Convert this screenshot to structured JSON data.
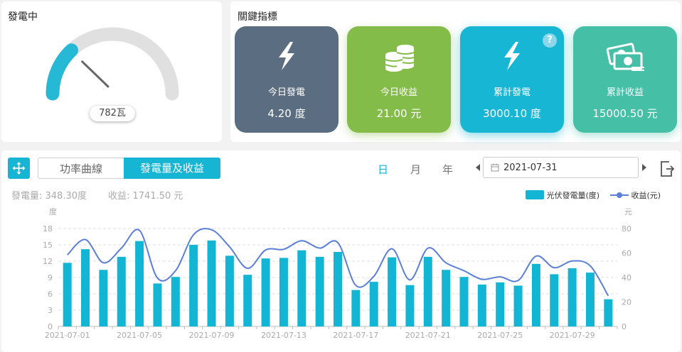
{
  "generating": {
    "title": "發電中",
    "value_text": "782瓦",
    "level": 0.26
  },
  "kpi": {
    "title": "關鍵指標",
    "cards": [
      {
        "label": "今日發電",
        "value": "4.20 度",
        "icon": "lightning-icon",
        "color": "#5b6d80"
      },
      {
        "label": "今日收益",
        "value": "21.00 元",
        "icon": "coins-icon",
        "color": "#84bc4a"
      },
      {
        "label": "累計發電",
        "value": "3000.10 度",
        "icon": "lightning-icon",
        "color": "#17b6d4",
        "help": "?"
      },
      {
        "label": "累計收益",
        "value": "15000.50 元",
        "icon": "money-icon",
        "color": "#45bfa5"
      }
    ]
  },
  "toolbar": {
    "tab_power": "功率曲線",
    "tab_energy": "發電量及收益",
    "active_tab": "發電量及收益",
    "day": "日",
    "month": "月",
    "year": "年",
    "active_period": "日",
    "date": "2021-07-31"
  },
  "summary": {
    "energy": "發電量:  348.30度",
    "income": "收益:  1741.50 元"
  },
  "chart_data": {
    "type": "bar",
    "left_unit": "度",
    "right_unit": "元",
    "y_left_ticks": [
      "0",
      "3",
      "6",
      "9",
      "12",
      "15",
      "18"
    ],
    "y_right_ticks": [
      "0",
      "20",
      "40",
      "60",
      "80"
    ],
    "ylim_left": [
      0,
      18
    ],
    "ylim_right": [
      0,
      80
    ],
    "x_tick_labels": [
      "2021-07-01",
      "2021-07-05",
      "2021-07-09",
      "2021-07-13",
      "2021-07-17",
      "2021-07-21",
      "2021-07-25",
      "2021-07-29"
    ],
    "categories": [
      "2021-07-01",
      "2021-07-02",
      "2021-07-03",
      "2021-07-04",
      "2021-07-05",
      "2021-07-06",
      "2021-07-07",
      "2021-07-08",
      "2021-07-09",
      "2021-07-10",
      "2021-07-11",
      "2021-07-12",
      "2021-07-13",
      "2021-07-14",
      "2021-07-15",
      "2021-07-16",
      "2021-07-17",
      "2021-07-18",
      "2021-07-19",
      "2021-07-20",
      "2021-07-21",
      "2021-07-22",
      "2021-07-23",
      "2021-07-24",
      "2021-07-25",
      "2021-07-26",
      "2021-07-27",
      "2021-07-28",
      "2021-07-29",
      "2021-07-30",
      "2021-07-31"
    ],
    "series": [
      {
        "name": "光伏發電量(度)",
        "type": "bar",
        "axis": "left",
        "color": "#12b5d3",
        "values": [
          11.7,
          14.2,
          10.4,
          12.8,
          15.7,
          7.9,
          9.1,
          15.0,
          15.8,
          13.0,
          9.5,
          12.5,
          12.6,
          14.0,
          12.8,
          13.7,
          6.7,
          8.2,
          12.7,
          7.6,
          12.8,
          10.4,
          9.1,
          7.7,
          8.1,
          7.5,
          11.5,
          9.6,
          10.7,
          9.9,
          5.0
        ]
      },
      {
        "name": "收益(元)",
        "type": "line",
        "axis": "right",
        "color": "#5b7fd6",
        "values": [
          58.5,
          71.0,
          52.0,
          64.0,
          78.5,
          39.5,
          45.5,
          75.0,
          79.0,
          65.0,
          47.5,
          62.5,
          63.0,
          70.0,
          64.0,
          68.5,
          33.5,
          41.0,
          63.5,
          38.0,
          64.0,
          52.0,
          45.5,
          38.5,
          40.5,
          37.5,
          57.5,
          48.0,
          53.5,
          49.5,
          25.0
        ]
      }
    ]
  }
}
